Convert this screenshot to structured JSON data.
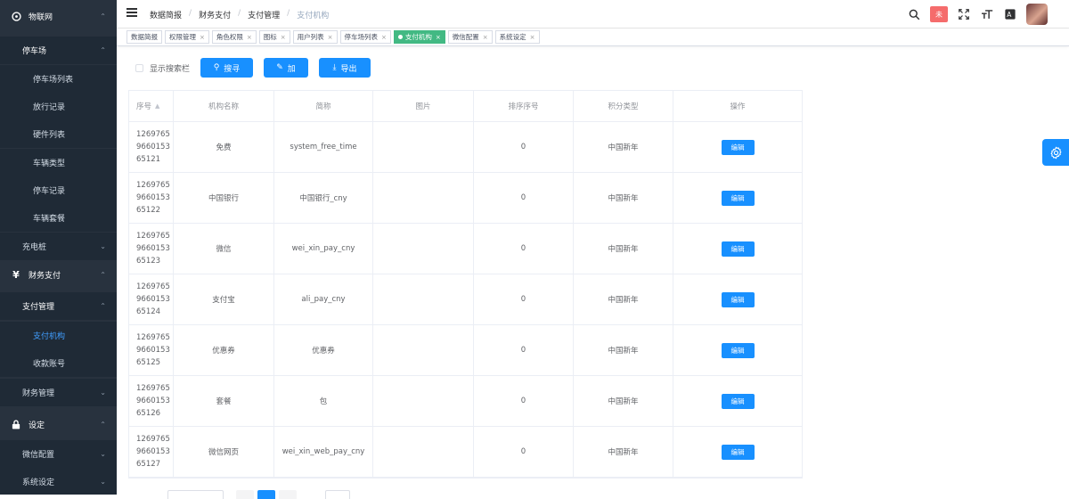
{
  "sidebar": {
    "items": [
      {
        "label": "物联网",
        "icon": "target-icon",
        "type": "group",
        "expanded": true
      },
      {
        "label": "停车场",
        "type": "submenu",
        "expanded": true
      },
      {
        "label": "停车场列表",
        "type": "leaf"
      },
      {
        "label": "放行记录",
        "type": "leaf"
      },
      {
        "label": "硬件列表",
        "type": "leaf"
      },
      {
        "label": "车辆类型",
        "type": "leaf"
      },
      {
        "label": "停车记录",
        "type": "leaf"
      },
      {
        "label": "车辆套餐",
        "type": "leaf"
      },
      {
        "label": "充电桩",
        "type": "submenu"
      },
      {
        "label": "财务支付",
        "icon": "yen-icon",
        "type": "group",
        "expanded": true
      },
      {
        "label": "支付管理",
        "type": "submenu",
        "expanded": true
      },
      {
        "label": "支付机构",
        "type": "leaf",
        "active": true
      },
      {
        "label": "收款账号",
        "type": "leaf"
      },
      {
        "label": "财务管理",
        "type": "submenu"
      },
      {
        "label": "设定",
        "icon": "lock-icon",
        "type": "group",
        "expanded": true
      },
      {
        "label": "微信配置",
        "type": "submenu"
      },
      {
        "label": "系统设定",
        "type": "submenu"
      }
    ]
  },
  "header": {
    "breadcrumb": [
      "数据简报",
      "财务支付",
      "支付管理",
      "支付机构"
    ],
    "badge_text": "未"
  },
  "tags": [
    {
      "label": "数据简报",
      "closable": false,
      "active": false
    },
    {
      "label": "权限管理",
      "closable": true,
      "active": false
    },
    {
      "label": "角色权限",
      "closable": true,
      "active": false
    },
    {
      "label": "图标",
      "closable": true,
      "active": false
    },
    {
      "label": "用户列表",
      "closable": true,
      "active": false
    },
    {
      "label": "停车场列表",
      "closable": true,
      "active": false
    },
    {
      "label": "支付机构",
      "closable": true,
      "active": true
    },
    {
      "label": "微信配置",
      "closable": true,
      "active": false
    },
    {
      "label": "系统设定",
      "closable": true,
      "active": false
    }
  ],
  "toolbar": {
    "show_search_label": "显示搜索栏",
    "search_label": "搜寻",
    "add_label": "加",
    "export_label": "导出"
  },
  "table": {
    "headers": [
      "序号",
      "机构名称",
      "简称",
      "图片",
      "排序序号",
      "积分类型",
      "操作"
    ],
    "rows": [
      {
        "id": "1269765\n9660153\n65121",
        "name": "免费",
        "short": "system_free_time",
        "image": "",
        "order": "0",
        "points": "中国新年",
        "action": "编辑"
      },
      {
        "id": "1269765\n9660153\n65122",
        "name": "中国银行",
        "short": "中国银行_cny",
        "image": "",
        "order": "0",
        "points": "中国新年",
        "action": "编辑"
      },
      {
        "id": "1269765\n9660153\n65123",
        "name": "微信",
        "short": "wei_xin_pay_cny",
        "image": "",
        "order": "0",
        "points": "中国新年",
        "action": "编辑"
      },
      {
        "id": "1269765\n9660153\n65124",
        "name": "支付宝",
        "short": "ali_pay_cny",
        "image": "",
        "order": "0",
        "points": "中国新年",
        "action": "编辑"
      },
      {
        "id": "1269765\n9660153\n65125",
        "name": "优惠券",
        "short": "优惠券",
        "image": "",
        "order": "0",
        "points": "中国新年",
        "action": "编辑"
      },
      {
        "id": "1269765\n9660153\n65126",
        "name": "套餐",
        "short": "包",
        "image": "",
        "order": "0",
        "points": "中国新年",
        "action": "编辑"
      },
      {
        "id": "1269765\n9660153\n65127",
        "name": "微信网页",
        "short": "wei_xin_web_pay_cny",
        "image": "",
        "order": "0",
        "points": "中国新年",
        "action": "编辑"
      }
    ]
  },
  "colors": {
    "sidebar_bg": "#28323e",
    "primary": "#1890ff",
    "active_tag": "#42b983",
    "active_menu": "#409eff"
  }
}
